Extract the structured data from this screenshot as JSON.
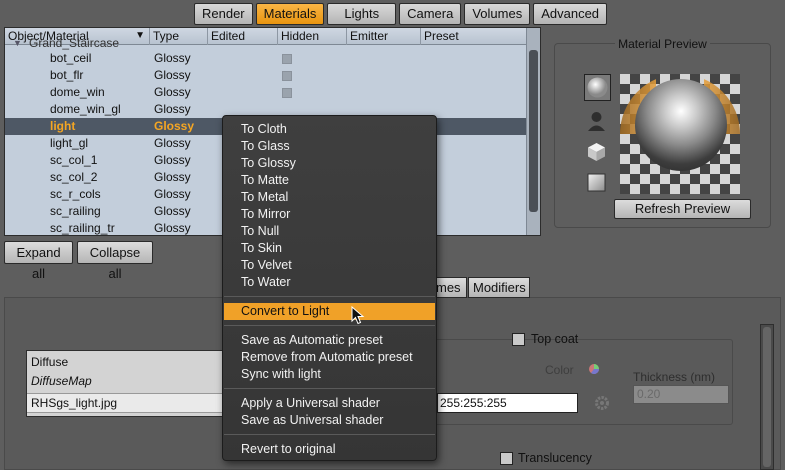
{
  "tabs": [
    {
      "label": "Render",
      "active": false
    },
    {
      "label": "Materials",
      "active": true
    },
    {
      "label": "Lights",
      "active": false
    },
    {
      "label": "Camera",
      "active": false
    },
    {
      "label": "Volumes",
      "active": false
    },
    {
      "label": "Advanced",
      "active": false
    }
  ],
  "table": {
    "columns": [
      "Object/Material",
      "Type",
      "Edited",
      "Hidden",
      "Emitter",
      "Preset"
    ],
    "group": "Grand_Staircase",
    "rows": [
      {
        "name": "bot_ceil",
        "type": "Glossy"
      },
      {
        "name": "bot_flr",
        "type": "Glossy"
      },
      {
        "name": "dome_win",
        "type": "Glossy"
      },
      {
        "name": "dome_win_gl",
        "type": "Glossy"
      },
      {
        "name": "light",
        "type": "Glossy"
      },
      {
        "name": "light_gl",
        "type": "Glossy"
      },
      {
        "name": "sc_col_1",
        "type": "Glossy"
      },
      {
        "name": "sc_col_2",
        "type": "Glossy"
      },
      {
        "name": "sc_r_cols",
        "type": "Glossy"
      },
      {
        "name": "sc_railing",
        "type": "Glossy"
      },
      {
        "name": "sc_railing_tr",
        "type": "Glossy"
      }
    ],
    "selected_index": 4
  },
  "buttons": {
    "expand_all": "Expand all",
    "collapse_all": "Collapse all",
    "refresh_preview": "Refresh Preview"
  },
  "preview": {
    "title": "Material Preview"
  },
  "subtabs": {
    "frames_partial": "mes",
    "modifiers": "Modifiers"
  },
  "diffuse": {
    "label": "Diffuse",
    "map_label": "DiffuseMap",
    "file": "RHSgs_light.jpg"
  },
  "topcoat": {
    "label": "Top coat",
    "color_label": "Color",
    "color_value": "255:255:255",
    "thickness_label": "Thickness (nm)",
    "thickness_value": "0.20"
  },
  "translucency": {
    "label": "Translucency"
  },
  "context_menu": {
    "convert_items": [
      "To Cloth",
      "To Glass",
      "To Glossy",
      "To Matte",
      "To Metal",
      "To Mirror",
      "To Null",
      "To Skin",
      "To Velvet",
      "To Water"
    ],
    "convert_light": "Convert to Light",
    "preset_items": [
      "Save as Automatic preset",
      "Remove from Automatic preset",
      "Sync with light"
    ],
    "shader_items": [
      "Apply a Universal shader",
      "Save as Universal shader"
    ],
    "revert": "Revert to original"
  },
  "colors": {
    "accent": "#f0a128",
    "tree_bg": "#c3cedb",
    "selected_row": "#4e5865",
    "menu_bg": "#3a3a3a"
  }
}
